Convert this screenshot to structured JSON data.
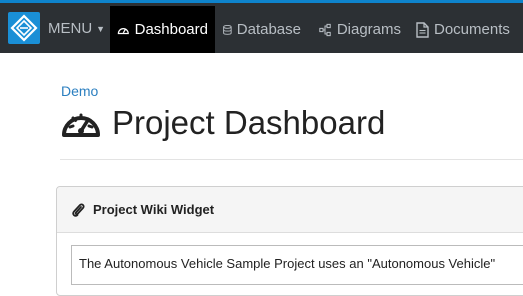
{
  "nav": {
    "menu_label": "MENU",
    "items": [
      {
        "label": "Dashboard",
        "icon": "dashboard-gauge-icon",
        "active": true
      },
      {
        "label": "Database",
        "icon": "database-icon",
        "active": false
      },
      {
        "label": "Diagrams",
        "icon": "diagram-icon",
        "active": false
      },
      {
        "label": "Documents",
        "icon": "document-icon",
        "active": false
      }
    ]
  },
  "breadcrumb": "Demo",
  "page": {
    "title": "Project Dashboard",
    "icon": "dashboard-gauge-icon"
  },
  "widget": {
    "title": "Project Wiki Widget",
    "icon": "paperclip-icon",
    "content": "The Autonomous Vehicle Sample Project uses an \"Autonomous Vehicle\""
  },
  "colors": {
    "topbar": "#2c3034",
    "accent": "#0e83cc",
    "logo": "#1a8fd6",
    "active_nav": "#000000",
    "link": "#2b7fc0"
  }
}
